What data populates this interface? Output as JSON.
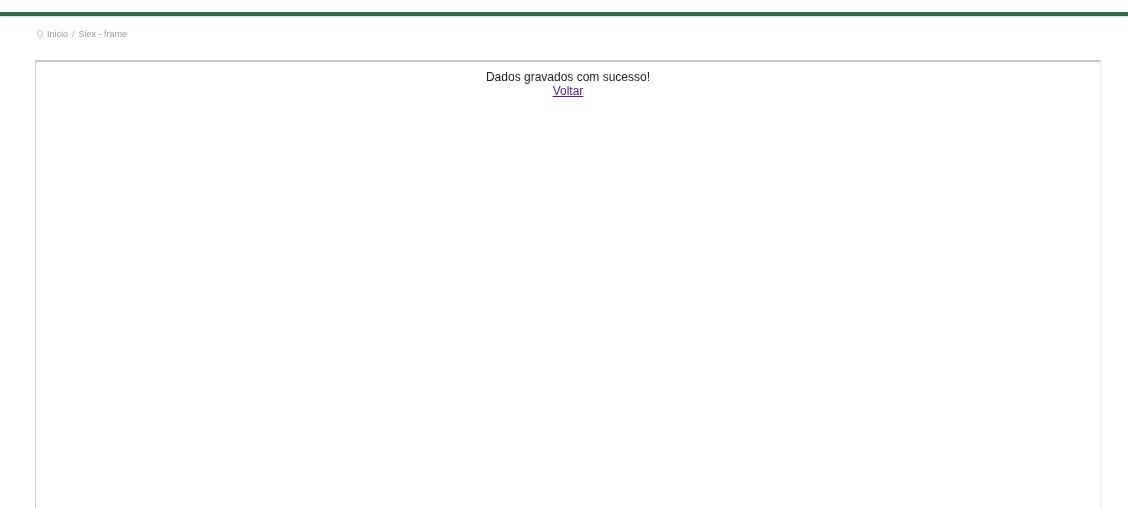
{
  "breadcrumb": [
    "Inicio",
    "Siex - frame"
  ],
  "breadcrumb_separator": "/",
  "frame": {
    "message": "Dados gravados com sucesso!",
    "link": "Voltar"
  }
}
